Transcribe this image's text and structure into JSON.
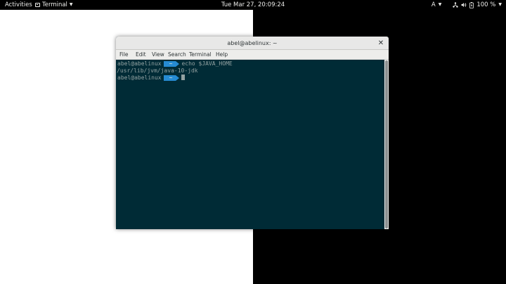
{
  "topbar": {
    "activities": "Activities",
    "app_name": "Terminal",
    "clock": "Tue Mar 27, 20:09:24",
    "input_source": "A",
    "battery": "100 %"
  },
  "window": {
    "title": "abel@abelinux: ~",
    "menu": [
      "File",
      "Edit",
      "View",
      "Search",
      "Terminal",
      "Help"
    ]
  },
  "terminal": {
    "prompt_user": "abel@abelinux",
    "prompt_path": "~",
    "command": "echo $JAVA_HOME",
    "output": "/usr/lib/jvm/java-10-jdk"
  },
  "colors": {
    "terminal_bg": "#002b36",
    "prompt_path_bg": "#268bd2",
    "terminal_fg": "#93a1a1"
  },
  "icons": [
    "terminal-app-icon",
    "chevron-down-icon",
    "network-icon",
    "volume-icon",
    "battery-icon",
    "close-icon"
  ]
}
